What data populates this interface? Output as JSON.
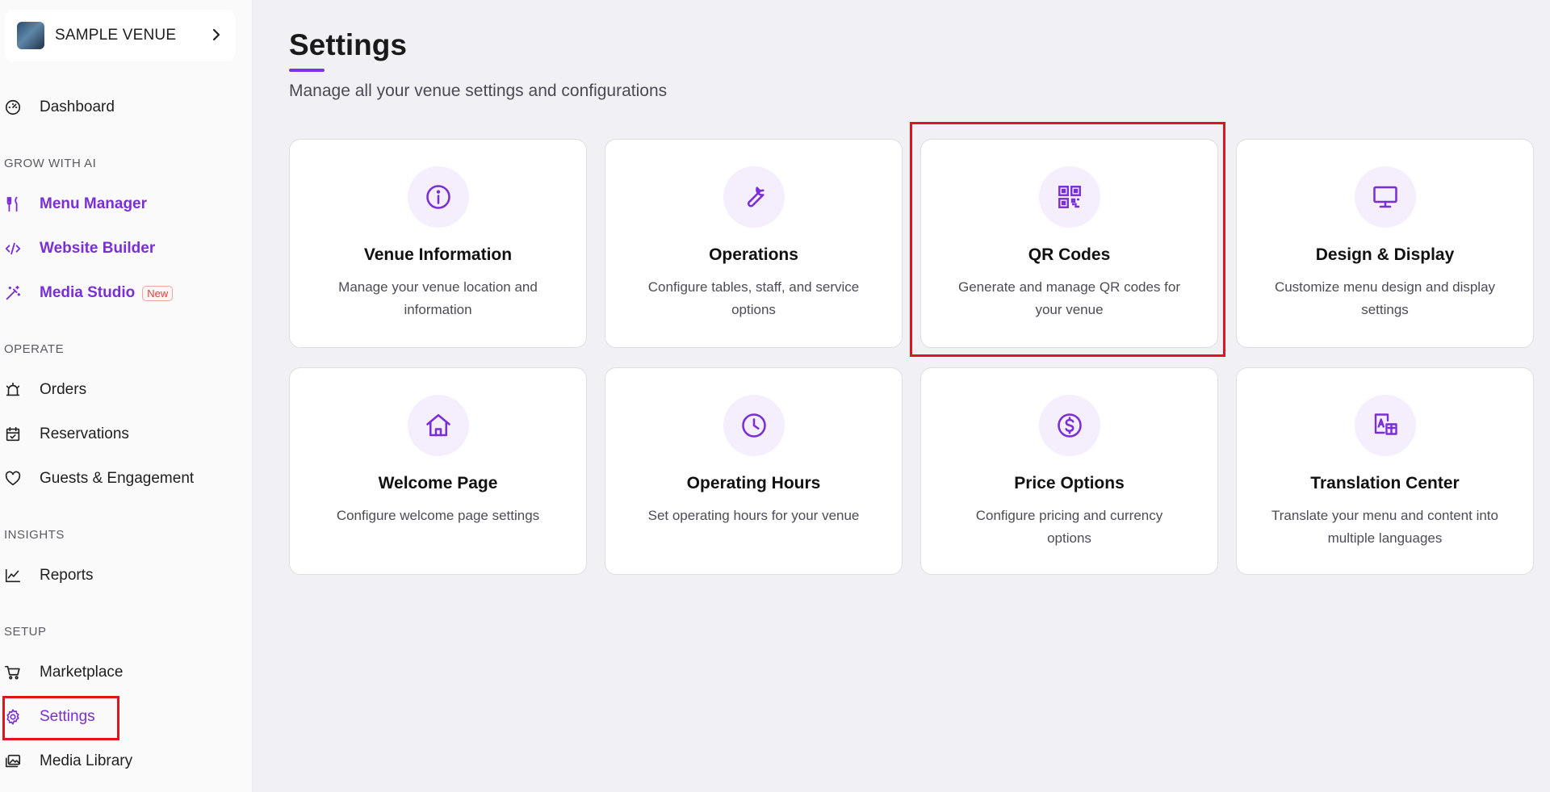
{
  "venue": {
    "name": "SAMPLE VENUE"
  },
  "nav": {
    "dashboard": "Dashboard",
    "section_grow": "GROW WITH AI",
    "menu_manager": "Menu Manager",
    "website_builder": "Website Builder",
    "media_studio": "Media Studio",
    "media_studio_badge": "New",
    "section_operate": "OPERATE",
    "orders": "Orders",
    "reservations": "Reservations",
    "guests": "Guests & Engagement",
    "section_insights": "INSIGHTS",
    "reports": "Reports",
    "section_setup": "SETUP",
    "marketplace": "Marketplace",
    "settings": "Settings",
    "media_library": "Media Library"
  },
  "page": {
    "title": "Settings",
    "subtitle": "Manage all your venue settings and configurations"
  },
  "cards": [
    {
      "icon": "info-icon",
      "title": "Venue Information",
      "desc": "Manage your venue location and information"
    },
    {
      "icon": "wrench-icon",
      "title": "Operations",
      "desc": "Configure tables, staff, and service options"
    },
    {
      "icon": "qr-code-icon",
      "title": "QR Codes",
      "desc": "Generate and manage QR codes for your venue"
    },
    {
      "icon": "monitor-icon",
      "title": "Design & Display",
      "desc": "Customize menu design and display settings"
    },
    {
      "icon": "home-icon",
      "title": "Welcome Page",
      "desc": "Configure welcome page settings"
    },
    {
      "icon": "clock-icon",
      "title": "Operating Hours",
      "desc": "Set operating hours for your venue"
    },
    {
      "icon": "dollar-icon",
      "title": "Price Options",
      "desc": "Configure pricing and currency options"
    },
    {
      "icon": "translate-icon",
      "title": "Translation Center",
      "desc": "Translate your menu and content into multiple languages"
    }
  ],
  "colors": {
    "accent": "#7b35d8",
    "highlight": "#e0141e",
    "icon_bg": "#f5eefc"
  }
}
